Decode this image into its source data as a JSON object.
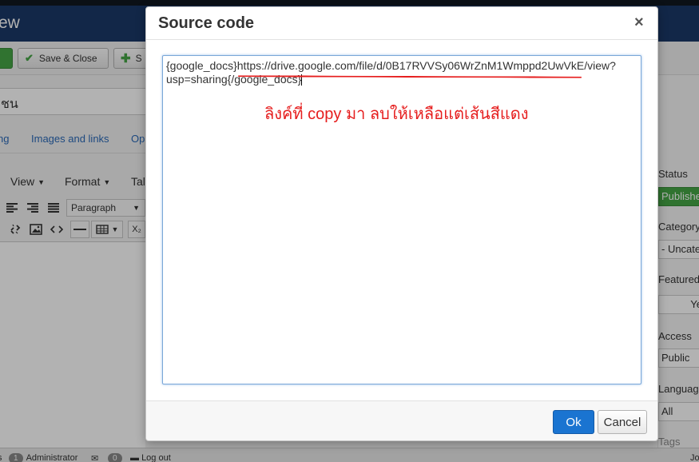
{
  "app": {
    "header_title": "ew",
    "toolbar": {
      "save_close_label": "Save & Close",
      "save_new_label": "S",
      "check_icon": "check-icon",
      "plus_icon": "plus-icon"
    },
    "title_value": "ชน",
    "tabs": [
      "ng",
      "Images and links",
      "Op"
    ],
    "editor_menu": {
      "view": "View",
      "format": "Format",
      "table": "Tal"
    },
    "editor_tools": {
      "paragraph": "Paragraph",
      "subscript": "X₂"
    },
    "sidebar": {
      "status_label": "Status",
      "status_value": "Published",
      "category_label": "Category",
      "category_value": "- Uncategorised",
      "featured_label": "Featured",
      "featured_value": "Ye",
      "access_label": "Access",
      "access_value": "Public",
      "language_label": "Language",
      "language_value": "All",
      "tags_label": "Tags"
    },
    "statusbar": {
      "views_text": "s",
      "admin_count": "1",
      "admin_label": "Administrator",
      "messages_count": "0",
      "logout_label": "Log out",
      "right_text": "Jo"
    }
  },
  "modal": {
    "title": "Source code",
    "close_symbol": "×",
    "code_line1_prefix": "{google_docs}",
    "code_line1_url": "https://drive.google.com/file/d/0B17RVVSy06WrZnM1Wmppd2UwVkE/view?",
    "code_line2": "usp=sharing{/google_docs}",
    "annotation": "ลิงค์ที่ copy มา ลบให้เหลือแต่เส้นสีแดง",
    "ok_label": "Ok",
    "cancel_label": "Cancel"
  },
  "colors": {
    "header_bg": "#1a3867",
    "accent_blue": "#1a74d1",
    "annotation_red": "#e61e1e",
    "published_green": "#46a546"
  }
}
